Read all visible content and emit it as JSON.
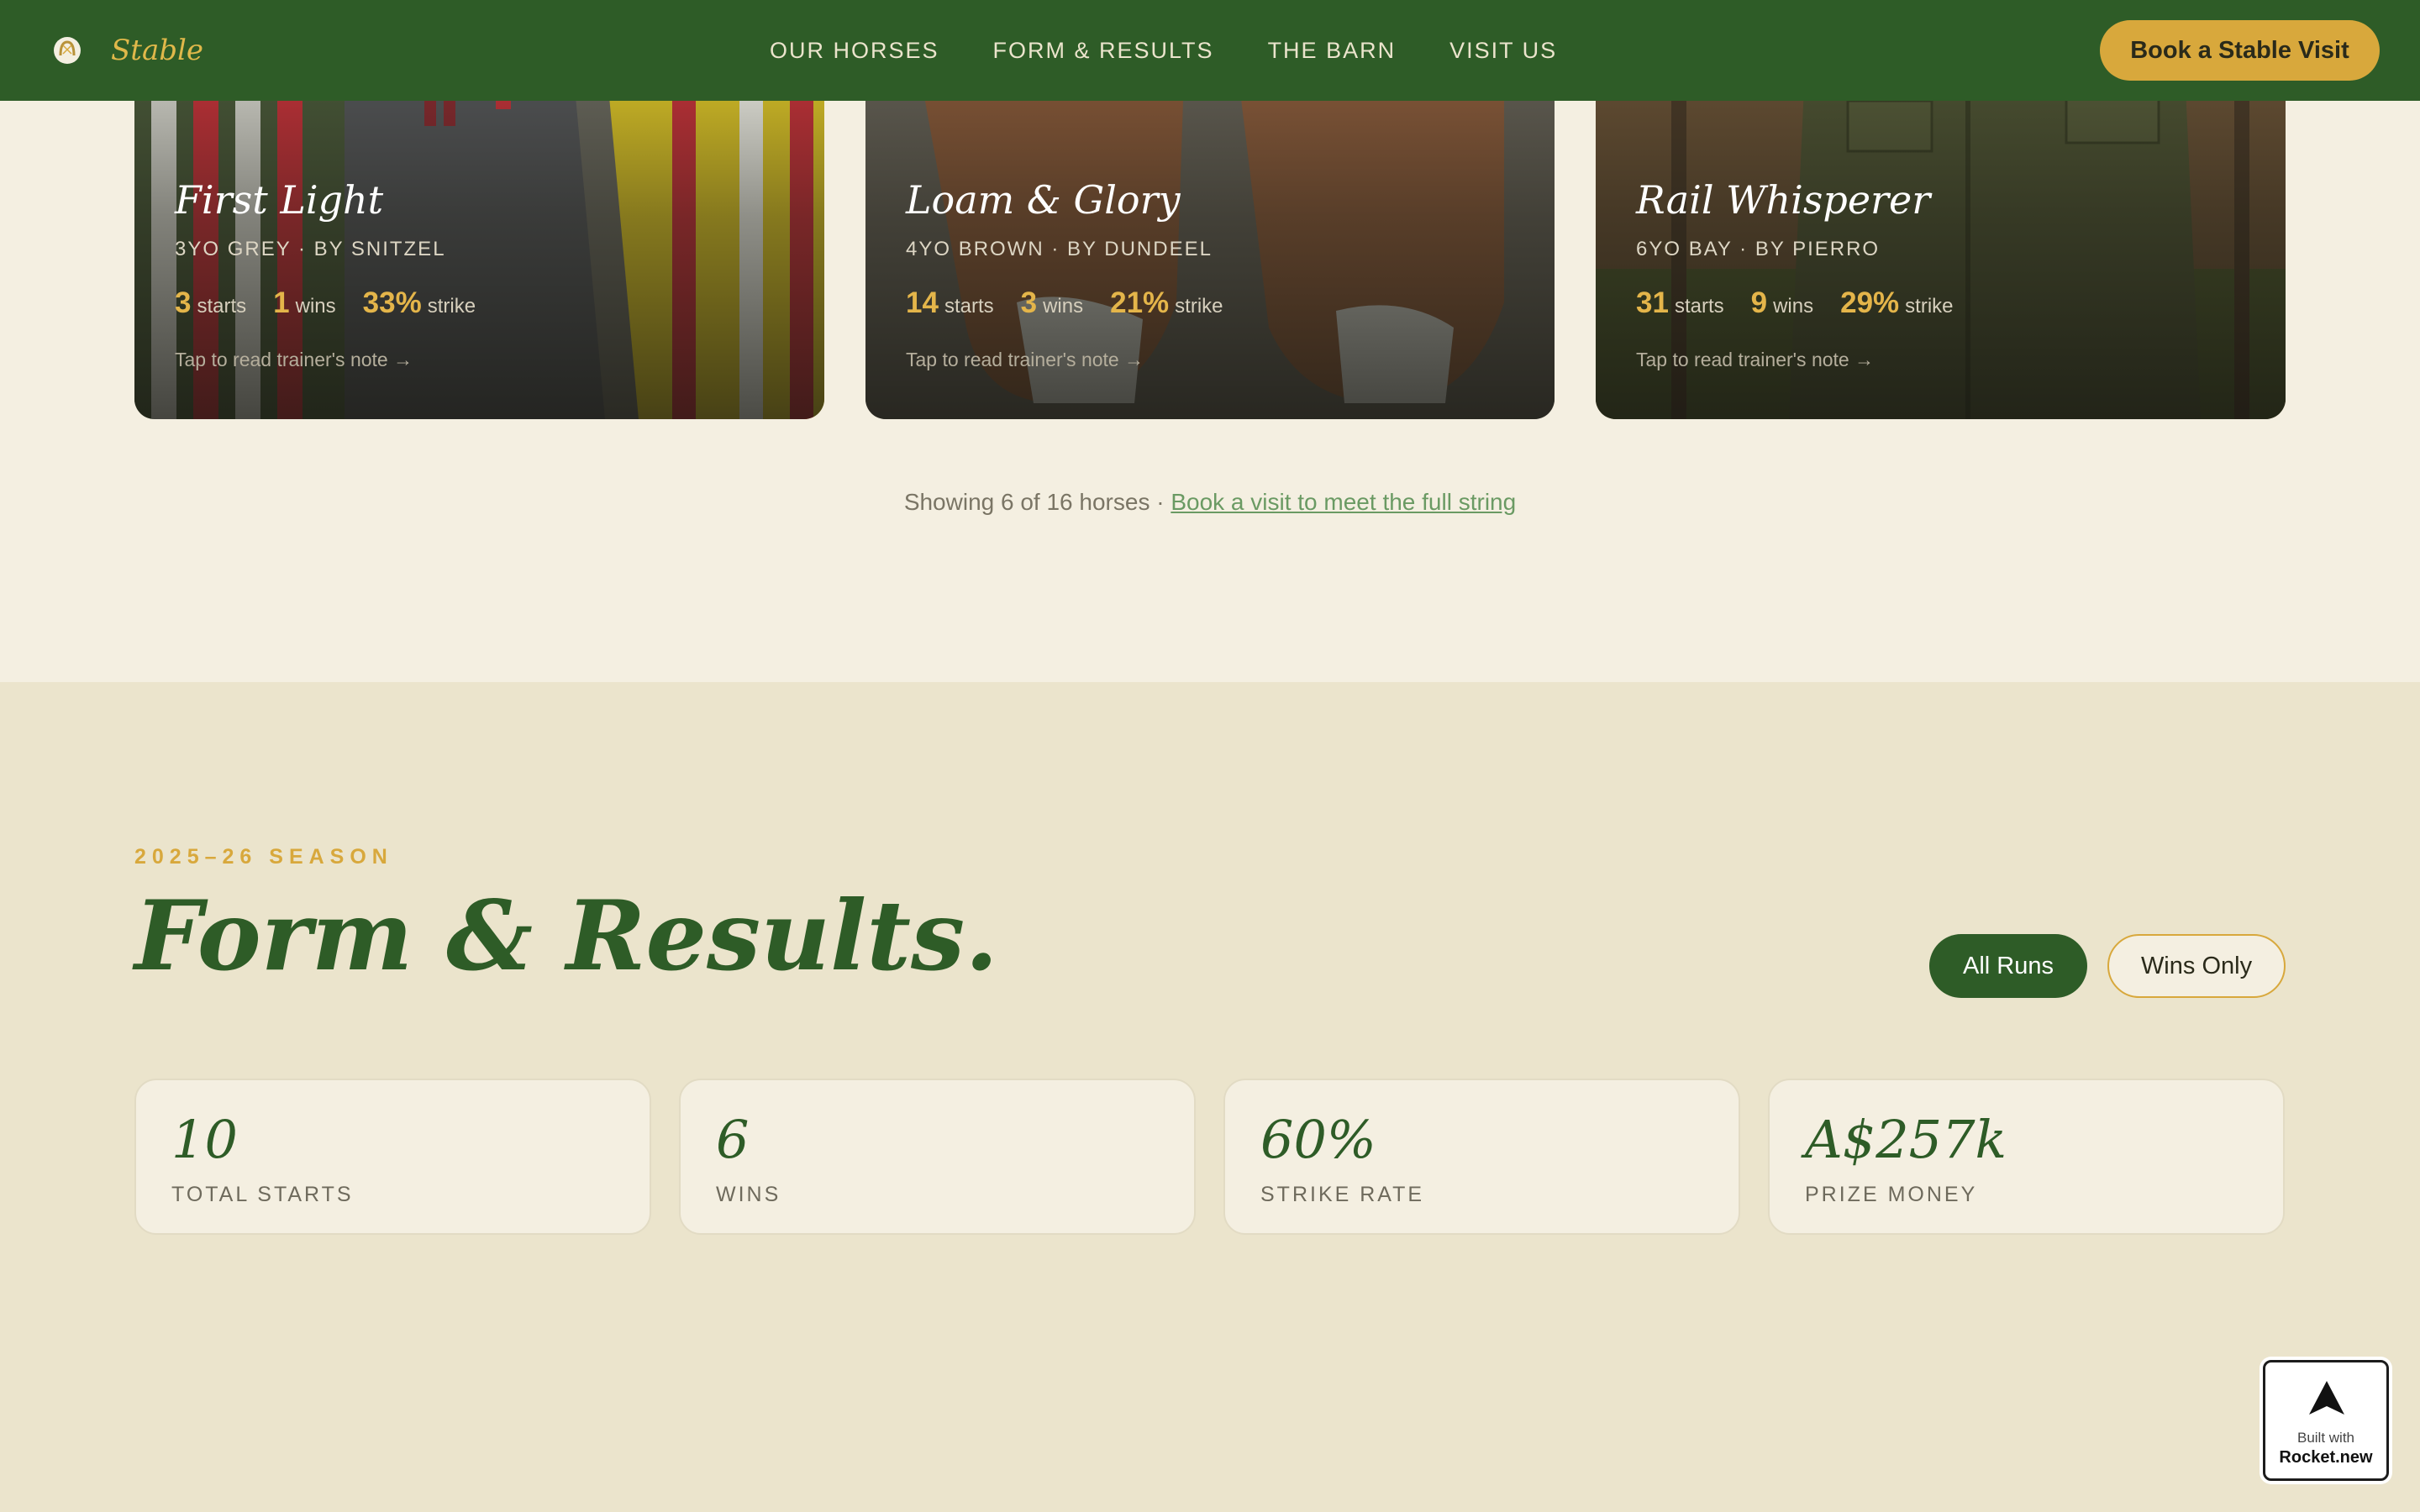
{
  "nav": {
    "brand": "Stable",
    "links": [
      "OUR HORSES",
      "FORM & RESULTS",
      "THE BARN",
      "VISIT US"
    ],
    "cta": "Book a Stable Visit"
  },
  "horses": [
    {
      "name": "First Light",
      "sub": "3YO GREY · BY SNITZEL",
      "starts": "3",
      "wins": "1",
      "strike": "33%",
      "starts_label": "starts",
      "wins_label": "wins",
      "strike_label": "strike",
      "note": "Tap to read trainer's note →"
    },
    {
      "name": "Loam & Glory",
      "sub": "4YO BROWN · BY DUNDEEL",
      "starts": "14",
      "wins": "3",
      "strike": "21%",
      "starts_label": "starts",
      "wins_label": "wins",
      "strike_label": "strike",
      "note": "Tap to read trainer's note →"
    },
    {
      "name": "Rail Whisperer",
      "sub": "6YO BAY · BY PIERRO",
      "starts": "31",
      "wins": "9",
      "strike": "29%",
      "starts_label": "starts",
      "wins_label": "wins",
      "strike_label": "strike",
      "note": "Tap to read trainer's note →"
    }
  ],
  "showing": {
    "text": "Showing 6 of 16 horses · ",
    "link": "Book a visit to meet the full string"
  },
  "form": {
    "season": "2025–26 SEASON",
    "title": "Form & Results.",
    "filters": [
      "All Runs",
      "Wins Only"
    ],
    "active_filter": "All Runs",
    "stats": [
      {
        "value": "10",
        "label": "TOTAL STARTS"
      },
      {
        "value": "6",
        "label": "WINS"
      },
      {
        "value": "60%",
        "label": "STRIKE RATE"
      },
      {
        "value": "A$257k",
        "label": "PRIZE MONEY"
      }
    ]
  },
  "badge": {
    "built": "Built with",
    "name": "Rocket.new"
  },
  "colors": {
    "nav_green": "#2e5c27",
    "gold": "#d8a83c",
    "cream": "#f4efe1",
    "beige": "#ebe4cc"
  }
}
